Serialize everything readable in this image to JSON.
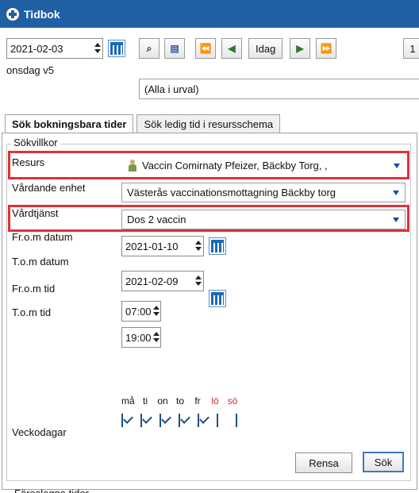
{
  "window": {
    "title": "Tidbok"
  },
  "toolbar": {
    "date": "2021-02-03",
    "weekday": "onsdag v5",
    "nav": [
      "⏪",
      "◀",
      "Idag",
      "▶",
      "⏩"
    ],
    "today_label": "Idag",
    "extra_button": "1",
    "filter_text": "(Alla i urval)"
  },
  "tabs": [
    {
      "label": "Sök bokningsbara tider",
      "active": true
    },
    {
      "label": "Sök ledig tid i resursschema",
      "active": false
    }
  ],
  "form": {
    "legend": "Sökvillkor",
    "resurs_label": "Resurs",
    "resurs_value": "Vaccin Comirnaty Pfeizer, Bäckby Torg, ,",
    "enhet_label": "Vårdande enhet",
    "enhet_value": "Västerås vaccinationsmottagning Bäckby torg",
    "tjanst_label": "Vårdtjänst",
    "tjanst_value": "Dos 2 vaccin",
    "from_date_label": "Fr.o.m datum",
    "from_date": "2021-01-10",
    "to_date_label": "T.o.m datum",
    "to_date": "2021-02-09",
    "from_time_label": "Fr.o.m tid",
    "from_time": "07:00",
    "to_time_label": "T.o.m tid",
    "to_time": "19:00",
    "weekdays_label": "Veckodagar",
    "days": [
      {
        "label": "må",
        "checked": true,
        "weekend": false
      },
      {
        "label": "ti",
        "checked": true,
        "weekend": false
      },
      {
        "label": "on",
        "checked": true,
        "weekend": false
      },
      {
        "label": "to",
        "checked": true,
        "weekend": false
      },
      {
        "label": "fr",
        "checked": true,
        "weekend": false
      },
      {
        "label": "lö",
        "checked": false,
        "weekend": true
      },
      {
        "label": "sö",
        "checked": false,
        "weekend": true
      }
    ],
    "clear_button": "Rensa",
    "search_button": "Sök"
  },
  "footer": {
    "section_title": "Föreslagna tider"
  },
  "colors": {
    "titlebar": "#1f5fa3",
    "highlight": "#e0303a",
    "weekend": "#d62828"
  }
}
